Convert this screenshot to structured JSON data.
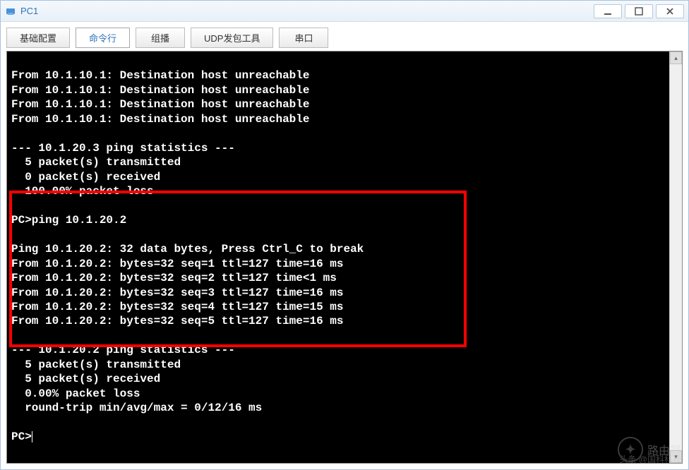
{
  "window": {
    "title": "PC1"
  },
  "tabs": [
    {
      "id": "basic",
      "label": "基础配置",
      "active": false
    },
    {
      "id": "cli",
      "label": "命令行",
      "active": true
    },
    {
      "id": "multicast",
      "label": "组播",
      "active": false
    },
    {
      "id": "udp",
      "label": "UDP发包工具",
      "active": false
    },
    {
      "id": "serial",
      "label": "串口",
      "active": false
    }
  ],
  "terminal": {
    "lines": [
      "From 10.1.10.1: Destination host unreachable",
      "From 10.1.10.1: Destination host unreachable",
      "From 10.1.10.1: Destination host unreachable",
      "From 10.1.10.1: Destination host unreachable",
      "",
      "--- 10.1.20.3 ping statistics ---",
      "  5 packet(s) transmitted",
      "  0 packet(s) received",
      "  100.00% packet loss",
      "",
      "PC>ping 10.1.20.2",
      "",
      "Ping 10.1.20.2: 32 data bytes, Press Ctrl_C to break",
      "From 10.1.20.2: bytes=32 seq=1 ttl=127 time=16 ms",
      "From 10.1.20.2: bytes=32 seq=2 ttl=127 time<1 ms",
      "From 10.1.20.2: bytes=32 seq=3 ttl=127 time=16 ms",
      "From 10.1.20.2: bytes=32 seq=4 ttl=127 time=15 ms",
      "From 10.1.20.2: bytes=32 seq=5 ttl=127 time=16 ms",
      "",
      "--- 10.1.20.2 ping statistics ---",
      "  5 packet(s) transmitted",
      "  5 packet(s) received",
      "  0.00% packet loss",
      "  round-trip min/avg/max = 0/12/16 ms",
      "",
      "PC>"
    ],
    "prompt": "PC>"
  },
  "watermark": {
    "brand": "路由器",
    "source": "头条 @国科科技"
  }
}
